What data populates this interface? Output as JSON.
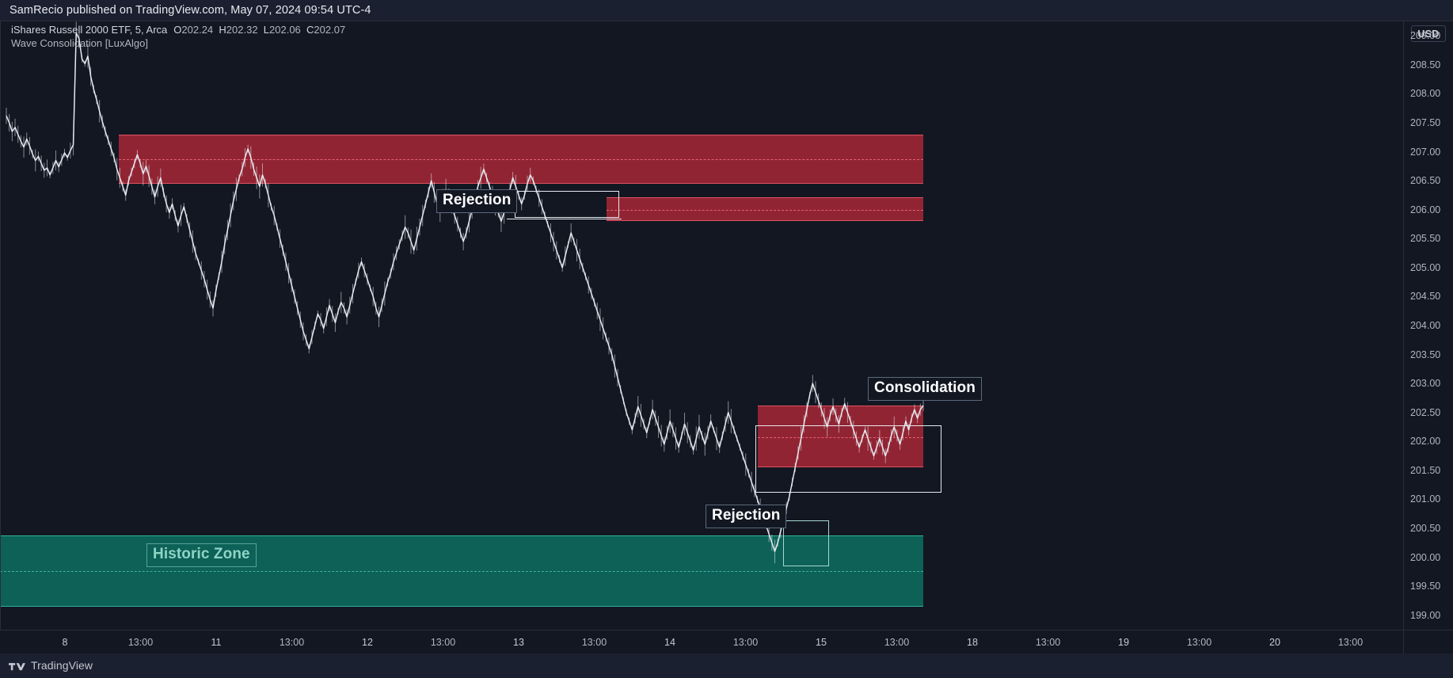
{
  "attribution": "SamRecio published on TradingView.com, May 07, 2024 09:54 UTC-4",
  "legend": {
    "symbol": "iShares Russell 2000 ETF, 5, Arca",
    "open_key": "O",
    "open": "202.24",
    "high_key": "H",
    "high": "202.32",
    "low_key": "L",
    "low": "202.06",
    "close_key": "C",
    "close": "202.07",
    "study": "Wave Consolidation [LuxAlgo]"
  },
  "price_axis": {
    "currency": "USD",
    "ticks": [
      "209.00",
      "208.50",
      "208.00",
      "207.50",
      "207.00",
      "206.50",
      "206.00",
      "205.50",
      "205.00",
      "204.50",
      "204.00",
      "203.50",
      "203.00",
      "202.50",
      "202.00",
      "201.50",
      "201.00",
      "200.50",
      "200.00",
      "199.50",
      "199.00"
    ]
  },
  "time_axis": {
    "ticks": [
      "8",
      "13:00",
      "11",
      "13:00",
      "12",
      "13:00",
      "13",
      "13:00",
      "14",
      "13:00",
      "15",
      "13:00",
      "18",
      "13:00",
      "19",
      "13:00",
      "20",
      "13:00"
    ]
  },
  "annotations": {
    "rejection_upper": "Rejection",
    "rejection_lower": "Rejection",
    "consolidation": "Consolidation",
    "historic_zone": "Historic Zone"
  },
  "watermark": {
    "text": "TradingView"
  },
  "colors": {
    "background": "#131722",
    "bear_zone": "#b22838",
    "bear_border": "#e05262",
    "bull_zone": "#0d6157",
    "bull_border": "#2fb39a",
    "series": "#e6e9ef",
    "axis_text": "#b2b5be",
    "grid": "#2a2e39"
  },
  "chart_data": {
    "type": "line",
    "title": "iShares Russell 2000 ETF, 5, Arca — Wave Consolidation [LuxAlgo]",
    "xlabel": "",
    "ylabel": "USD",
    "ylim": [
      198.75,
      209.25
    ],
    "grid": false,
    "legend_position": "top-left",
    "ohlc_last": {
      "open": 202.24,
      "high": 202.32,
      "low": 202.06,
      "close": 202.07
    },
    "xtick_labels": [
      "8",
      "13:00",
      "11",
      "13:00",
      "12",
      "13:00",
      "13",
      "13:00",
      "14",
      "13:00",
      "15",
      "13:00",
      "18",
      "13:00",
      "19",
      "13:00",
      "20",
      "13:00"
    ],
    "ytick_labels": [
      "209.00",
      "208.50",
      "208.00",
      "207.50",
      "207.00",
      "206.50",
      "206.00",
      "205.50",
      "205.00",
      "204.50",
      "204.00",
      "203.50",
      "203.00",
      "202.50",
      "202.00",
      "201.50",
      "201.00",
      "200.50",
      "200.00",
      "199.50",
      "199.00"
    ],
    "zones": [
      {
        "name": "Rejection zone (upper)",
        "kind": "bear",
        "price_top": 207.3,
        "price_bottom": 206.45,
        "price_mid": 206.88,
        "x_start_label": "near 10",
        "x_end_label": "near 16"
      },
      {
        "name": "Rejection zone (lower)",
        "kind": "bear",
        "price_top": 206.22,
        "price_bottom": 205.8,
        "price_mid": 206.01,
        "x_start_label": "near 13:30 on 13",
        "x_end_label": "near 16"
      },
      {
        "name": "Consolidation zone",
        "kind": "bear",
        "price_top": 202.62,
        "price_bottom": 201.55,
        "price_mid": 202.08,
        "x_start_label": "near 14:00 on 14",
        "x_end_label": "near 16"
      },
      {
        "name": "Historic Zone",
        "kind": "bull",
        "price_top": 200.38,
        "price_bottom": 199.15,
        "price_mid": 199.77,
        "x_start_label": "chart start",
        "x_end_label": "near 16"
      }
    ],
    "series": [
      {
        "name": "Close",
        "color": "#e6e9ef",
        "y": [
          207.62,
          207.5,
          207.35,
          207.42,
          207.3,
          207.18,
          207.08,
          207.22,
          207.1,
          206.96,
          206.85,
          206.92,
          206.8,
          206.68,
          206.72,
          206.6,
          206.72,
          206.85,
          206.74,
          206.86,
          206.98,
          206.9,
          207.02,
          207.12,
          209.05,
          208.95,
          208.6,
          208.52,
          208.65,
          208.3,
          208.08,
          207.9,
          207.7,
          207.52,
          207.35,
          207.2,
          207.05,
          206.9,
          206.7,
          206.55,
          206.4,
          206.25,
          206.5,
          206.65,
          206.8,
          206.95,
          206.8,
          206.62,
          206.75,
          206.58,
          206.4,
          206.22,
          206.4,
          206.55,
          206.3,
          206.1,
          205.95,
          206.1,
          205.9,
          205.72,
          205.9,
          206.05,
          205.85,
          205.65,
          205.45,
          205.25,
          205.1,
          204.95,
          204.8,
          204.62,
          204.45,
          204.3,
          204.6,
          204.85,
          205.1,
          205.4,
          205.65,
          205.9,
          206.15,
          206.35,
          206.55,
          206.7,
          206.9,
          207.05,
          206.9,
          206.7,
          206.55,
          206.4,
          206.6,
          206.45,
          206.25,
          206.05,
          205.9,
          205.7,
          205.5,
          205.3,
          205.1,
          204.9,
          204.7,
          204.5,
          204.3,
          204.1,
          203.9,
          203.75,
          203.6,
          203.8,
          204.0,
          204.2,
          204.1,
          203.95,
          204.15,
          204.35,
          204.2,
          204.05,
          204.25,
          204.4,
          204.3,
          204.15,
          204.35,
          204.55,
          204.75,
          204.95,
          205.1,
          204.95,
          204.8,
          204.65,
          204.5,
          204.3,
          204.15,
          204.35,
          204.55,
          204.75,
          204.9,
          205.1,
          205.25,
          205.4,
          205.55,
          205.7,
          205.6,
          205.45,
          205.3,
          205.5,
          205.7,
          205.9,
          206.1,
          206.3,
          206.5,
          206.3,
          206.1,
          205.95,
          206.15,
          206.35,
          206.2,
          206.05,
          205.9,
          205.75,
          205.6,
          205.45,
          205.6,
          205.8,
          206.0,
          206.2,
          206.4,
          206.55,
          206.7,
          206.55,
          206.4,
          206.25,
          206.1,
          205.95,
          205.8,
          205.95,
          206.15,
          206.35,
          206.55,
          206.4,
          206.25,
          206.1,
          206.25,
          206.45,
          206.6,
          206.5,
          206.35,
          206.2,
          206.05,
          205.9,
          205.75,
          205.6,
          205.45,
          205.3,
          205.15,
          205.0,
          205.2,
          205.4,
          205.6,
          205.45,
          205.3,
          205.15,
          205.0,
          204.85,
          204.7,
          204.55,
          204.4,
          204.25,
          204.1,
          203.95,
          203.8,
          203.65,
          203.5,
          203.3,
          203.1,
          202.9,
          202.7,
          202.5,
          202.35,
          202.2,
          202.4,
          202.6,
          202.45,
          202.3,
          202.15,
          202.35,
          202.55,
          202.4,
          202.25,
          202.1,
          201.95,
          202.15,
          202.35,
          202.2,
          202.05,
          201.9,
          202.1,
          202.3,
          202.15,
          202.0,
          201.85,
          202.05,
          202.25,
          202.1,
          201.95,
          202.15,
          202.35,
          202.2,
          202.05,
          201.9,
          202.1,
          202.3,
          202.5,
          202.35,
          202.2,
          202.05,
          201.9,
          201.75,
          201.6,
          201.45,
          201.3,
          201.15,
          201.0,
          200.85,
          200.7,
          200.55,
          200.4,
          200.25,
          200.1,
          200.25,
          200.45,
          200.65,
          200.85,
          201.05,
          201.3,
          201.55,
          201.8,
          202.05,
          202.3,
          202.55,
          202.8,
          203.0,
          202.85,
          202.7,
          202.55,
          202.4,
          202.25,
          202.45,
          202.6,
          202.45,
          202.3,
          202.5,
          202.65,
          202.5,
          202.35,
          202.2,
          202.05,
          201.9,
          202.05,
          202.2,
          202.05,
          201.9,
          201.75,
          201.9,
          202.05,
          201.9,
          201.75,
          201.9,
          202.1,
          202.25,
          202.1,
          201.95,
          202.15,
          202.35,
          202.2,
          202.4,
          202.55,
          202.4,
          202.55,
          202.62
        ]
      }
    ]
  }
}
